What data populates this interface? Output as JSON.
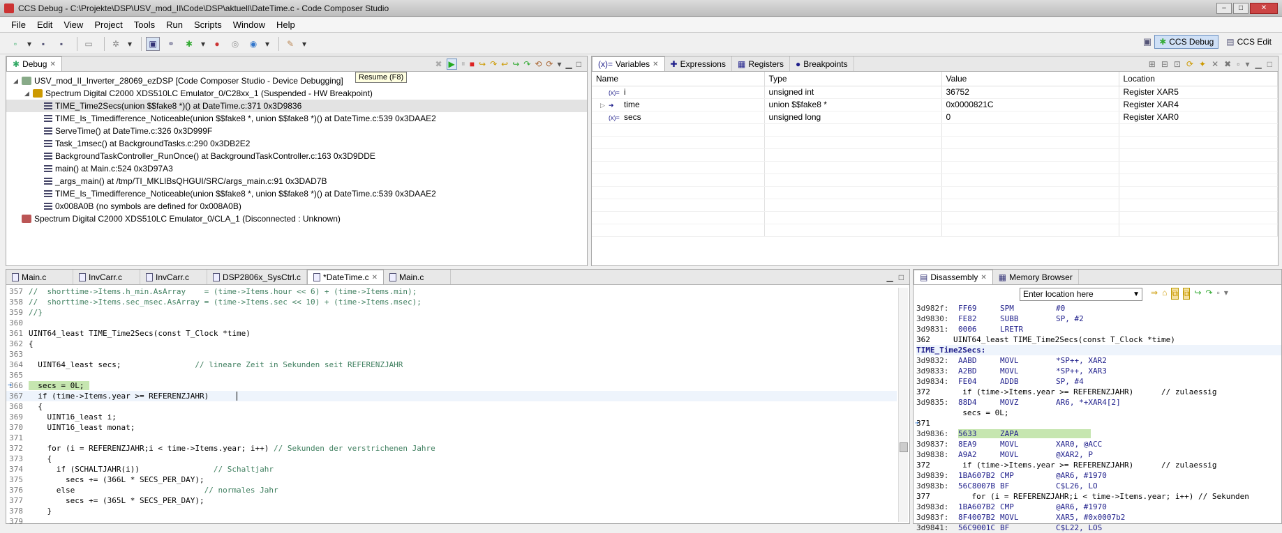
{
  "window": {
    "title": "CCS Debug - C:\\Projekte\\DSP\\USV_mod_II\\Code\\DSP\\aktuell\\DateTime.c - Code Composer Studio",
    "controls": [
      "–",
      "□",
      "✕"
    ]
  },
  "menu": [
    "File",
    "Edit",
    "View",
    "Project",
    "Tools",
    "Run",
    "Scripts",
    "Window",
    "Help"
  ],
  "perspectives": {
    "debug": "CCS Debug",
    "edit": "CCS Edit"
  },
  "debug_view": {
    "tab": "Debug",
    "tooltip": "Resume (F8)",
    "tree": [
      {
        "level": 0,
        "icon": "device-debugging-icon",
        "text": "USV_mod_II_Inverter_28069_ezDSP [Code Composer Studio - Device Debugging]"
      },
      {
        "level": 1,
        "icon": "cpu-suspended-icon",
        "text": "Spectrum Digital C2000 XDS510LC Emulator_0/C28xx_1 (Suspended - HW Breakpoint)"
      },
      {
        "level": 2,
        "icon": "stack-frame-icon",
        "text": "TIME_Time2Secs(union $$fake8 *)() at DateTime.c:371 0x3D9836",
        "selected": true
      },
      {
        "level": 2,
        "icon": "stack-frame-icon",
        "text": "TIME_Is_Timedifference_Noticeable(union $$fake8 *, union $$fake8 *)() at DateTime.c:539 0x3DAAE2"
      },
      {
        "level": 2,
        "icon": "stack-frame-icon",
        "text": "ServeTime() at DateTime.c:326 0x3D999F"
      },
      {
        "level": 2,
        "icon": "stack-frame-icon",
        "text": "Task_1msec() at BackgroundTasks.c:290 0x3DB2E2"
      },
      {
        "level": 2,
        "icon": "stack-frame-icon",
        "text": "BackgroundTaskController_RunOnce() at BackgroundTaskController.c:163 0x3D9DDE"
      },
      {
        "level": 2,
        "icon": "stack-frame-icon",
        "text": "main() at Main.c:524 0x3D97A3"
      },
      {
        "level": 2,
        "icon": "stack-frame-icon",
        "text": "_args_main() at /tmp/TI_MKLIBsQHGUI/SRC/args_main.c:91 0x3DAD7B"
      },
      {
        "level": 2,
        "icon": "stack-frame-icon",
        "text": "TIME_Is_Timedifference_Noticeable(union $$fake8 *, union $$fake8 *)() at DateTime.c:539 0x3DAAE2"
      },
      {
        "level": 2,
        "icon": "stack-frame-icon",
        "text": "0x008A0B  (no symbols are defined for 0x008A0B)"
      },
      {
        "level": 0,
        "icon": "cpu-disconnected-icon",
        "text": "Spectrum Digital C2000 XDS510LC Emulator_0/CLA_1 (Disconnected : Unknown)"
      }
    ]
  },
  "variables_view": {
    "tabs": [
      "Variables",
      "Expressions",
      "Registers",
      "Breakpoints"
    ],
    "columns": [
      "Name",
      "Type",
      "Value",
      "Location"
    ],
    "rows": [
      {
        "name": "i",
        "type": "unsigned int",
        "value": "36752",
        "location": "Register XAR5",
        "expandable": false
      },
      {
        "name": "time",
        "type": "union $$fake8 *",
        "value": "0x0000821C",
        "location": "Register XAR4",
        "expandable": true
      },
      {
        "name": "secs",
        "type": "unsigned long",
        "value": "0",
        "location": "Register XAR0",
        "expandable": false
      }
    ]
  },
  "editor": {
    "tabs": [
      {
        "label": "Main.c",
        "active": false
      },
      {
        "label": "InvCarr.c",
        "active": false
      },
      {
        "label": "InvCarr.c",
        "active": false
      },
      {
        "label": "DSP2806x_SysCtrl.c",
        "active": false
      },
      {
        "label": "*DateTime.c",
        "active": true
      },
      {
        "label": "Main.c",
        "active": false
      }
    ],
    "lines": [
      {
        "n": "357",
        "code": "//  shorttime->Items.h_min.AsArray    = (time->Items.hour << 6) + (time->Items.min);",
        "kind": "comment"
      },
      {
        "n": "358",
        "code": "//  shorttime->Items.sec_msec.AsArray = (time->Items.sec << 10) + (time->Items.msec);",
        "kind": "comment"
      },
      {
        "n": "359",
        "code": "//}",
        "kind": "comment"
      },
      {
        "n": "360",
        "code": "",
        "kind": "normal"
      },
      {
        "n": "361",
        "code": "UINT64_least TIME_Time2Secs(const T_Clock *time)",
        "kind": "normal"
      },
      {
        "n": "362",
        "code": "{",
        "kind": "normal"
      },
      {
        "n": "363",
        "code": "",
        "kind": "normal"
      },
      {
        "n": "364",
        "code": "  UINT64_least secs;",
        "comment": "                // lineare Zeit in Sekunden seit REFERENZJAHR",
        "kind": "normal"
      },
      {
        "n": "365",
        "code": "",
        "kind": "normal"
      },
      {
        "n": "366",
        "code": "  secs = 0L;",
        "kind": "pc"
      },
      {
        "n": "367",
        "code": "  if (time->Items.year >= REFERENZJAHR)",
        "kind": "cursor"
      },
      {
        "n": "368",
        "code": "  {",
        "kind": "normal"
      },
      {
        "n": "369",
        "code": "    UINT16_least i;",
        "kind": "normal"
      },
      {
        "n": "370",
        "code": "    UINT16_least monat;",
        "kind": "normal"
      },
      {
        "n": "371",
        "code": "",
        "kind": "normal"
      },
      {
        "n": "372",
        "code": "    for (i = REFERENZJAHR;i < time->Items.year; i++)",
        "comment": " // Sekunden der verstrichenen Jahre",
        "kind": "normal"
      },
      {
        "n": "373",
        "code": "    {",
        "kind": "normal"
      },
      {
        "n": "374",
        "code": "      if (SCHALTJAHR(i))",
        "comment": "                // Schaltjahr",
        "kind": "normal"
      },
      {
        "n": "375",
        "code": "        secs += (366L * SECS_PER_DAY);",
        "kind": "normal"
      },
      {
        "n": "376",
        "code": "      else",
        "comment": "                            // normales Jahr",
        "kind": "normal"
      },
      {
        "n": "377",
        "code": "        secs += (365L * SECS_PER_DAY);",
        "kind": "normal"
      },
      {
        "n": "378",
        "code": "    }",
        "kind": "normal"
      },
      {
        "n": "379",
        "code": "",
        "kind": "normal"
      }
    ]
  },
  "disassembly": {
    "tabs": [
      "Disassembly",
      "Memory Browser"
    ],
    "location_placeholder": "Enter location here",
    "lines": [
      {
        "addr": "3d982f:",
        "op": "FF69",
        "mn": "SPM",
        "args": "#0"
      },
      {
        "addr": "3d9830:",
        "op": "FE82",
        "mn": "SUBB",
        "args": "SP, #2"
      },
      {
        "addr": "3d9831:",
        "op": "0006",
        "mn": "LRETR",
        "args": ""
      },
      {
        "src": "362     UINT64_least TIME_Time2Secs(const T_Clock *time)"
      },
      {
        "label": "TIME_Time2Secs:"
      },
      {
        "addr": "3d9832:",
        "op": "AABD",
        "mn": "MOVL",
        "args": "*SP++, XAR2"
      },
      {
        "addr": "3d9833:",
        "op": "A2BD",
        "mn": "MOVL",
        "args": "*SP++, XAR3"
      },
      {
        "addr": "3d9834:",
        "op": "FE04",
        "mn": "ADDB",
        "args": "SP, #4"
      },
      {
        "src": "372       if (time->Items.year >= REFERENZJAHR)      // zulaessig"
      },
      {
        "addr": "3d9835:",
        "op": "88D4",
        "mn": "MOVZ",
        "args": "AR6, *+XAR4[2]"
      },
      {
        "src": "          secs = 0L;"
      },
      {
        "src": "371",
        "marker": true
      },
      {
        "addr": "3d9836:",
        "op": "5633",
        "mn": "ZAPA",
        "args": "",
        "pc": true
      },
      {
        "addr": "3d9837:",
        "op": "8EA9",
        "mn": "MOVL",
        "args": "XAR0, @ACC"
      },
      {
        "addr": "3d9838:",
        "op": "A9A2",
        "mn": "MOVL",
        "args": "@XAR2, P"
      },
      {
        "src": "372       if (time->Items.year >= REFERENZJAHR)      // zulaessig"
      },
      {
        "addr": "3d9839:",
        "op": "1BA607B2",
        "mn": "CMP",
        "args": "@AR6, #1970"
      },
      {
        "addr": "3d983b:",
        "op": "56C8007B",
        "mn": "BF",
        "args": "C$L26, LO"
      },
      {
        "src": "377         for (i = REFERENZJAHR;i < time->Items.year; i++) // Sekunden"
      },
      {
        "addr": "3d983d:",
        "op": "1BA607B2",
        "mn": "CMP",
        "args": "@AR6, #1970"
      },
      {
        "addr": "3d983f:",
        "op": "8F4007B2",
        "mn": "MOVL",
        "args": "XAR5, #0x0007b2"
      },
      {
        "addr": "3d9841:",
        "op": "56C9001C",
        "mn": "BF",
        "args": "C$L22, LOS"
      }
    ]
  }
}
